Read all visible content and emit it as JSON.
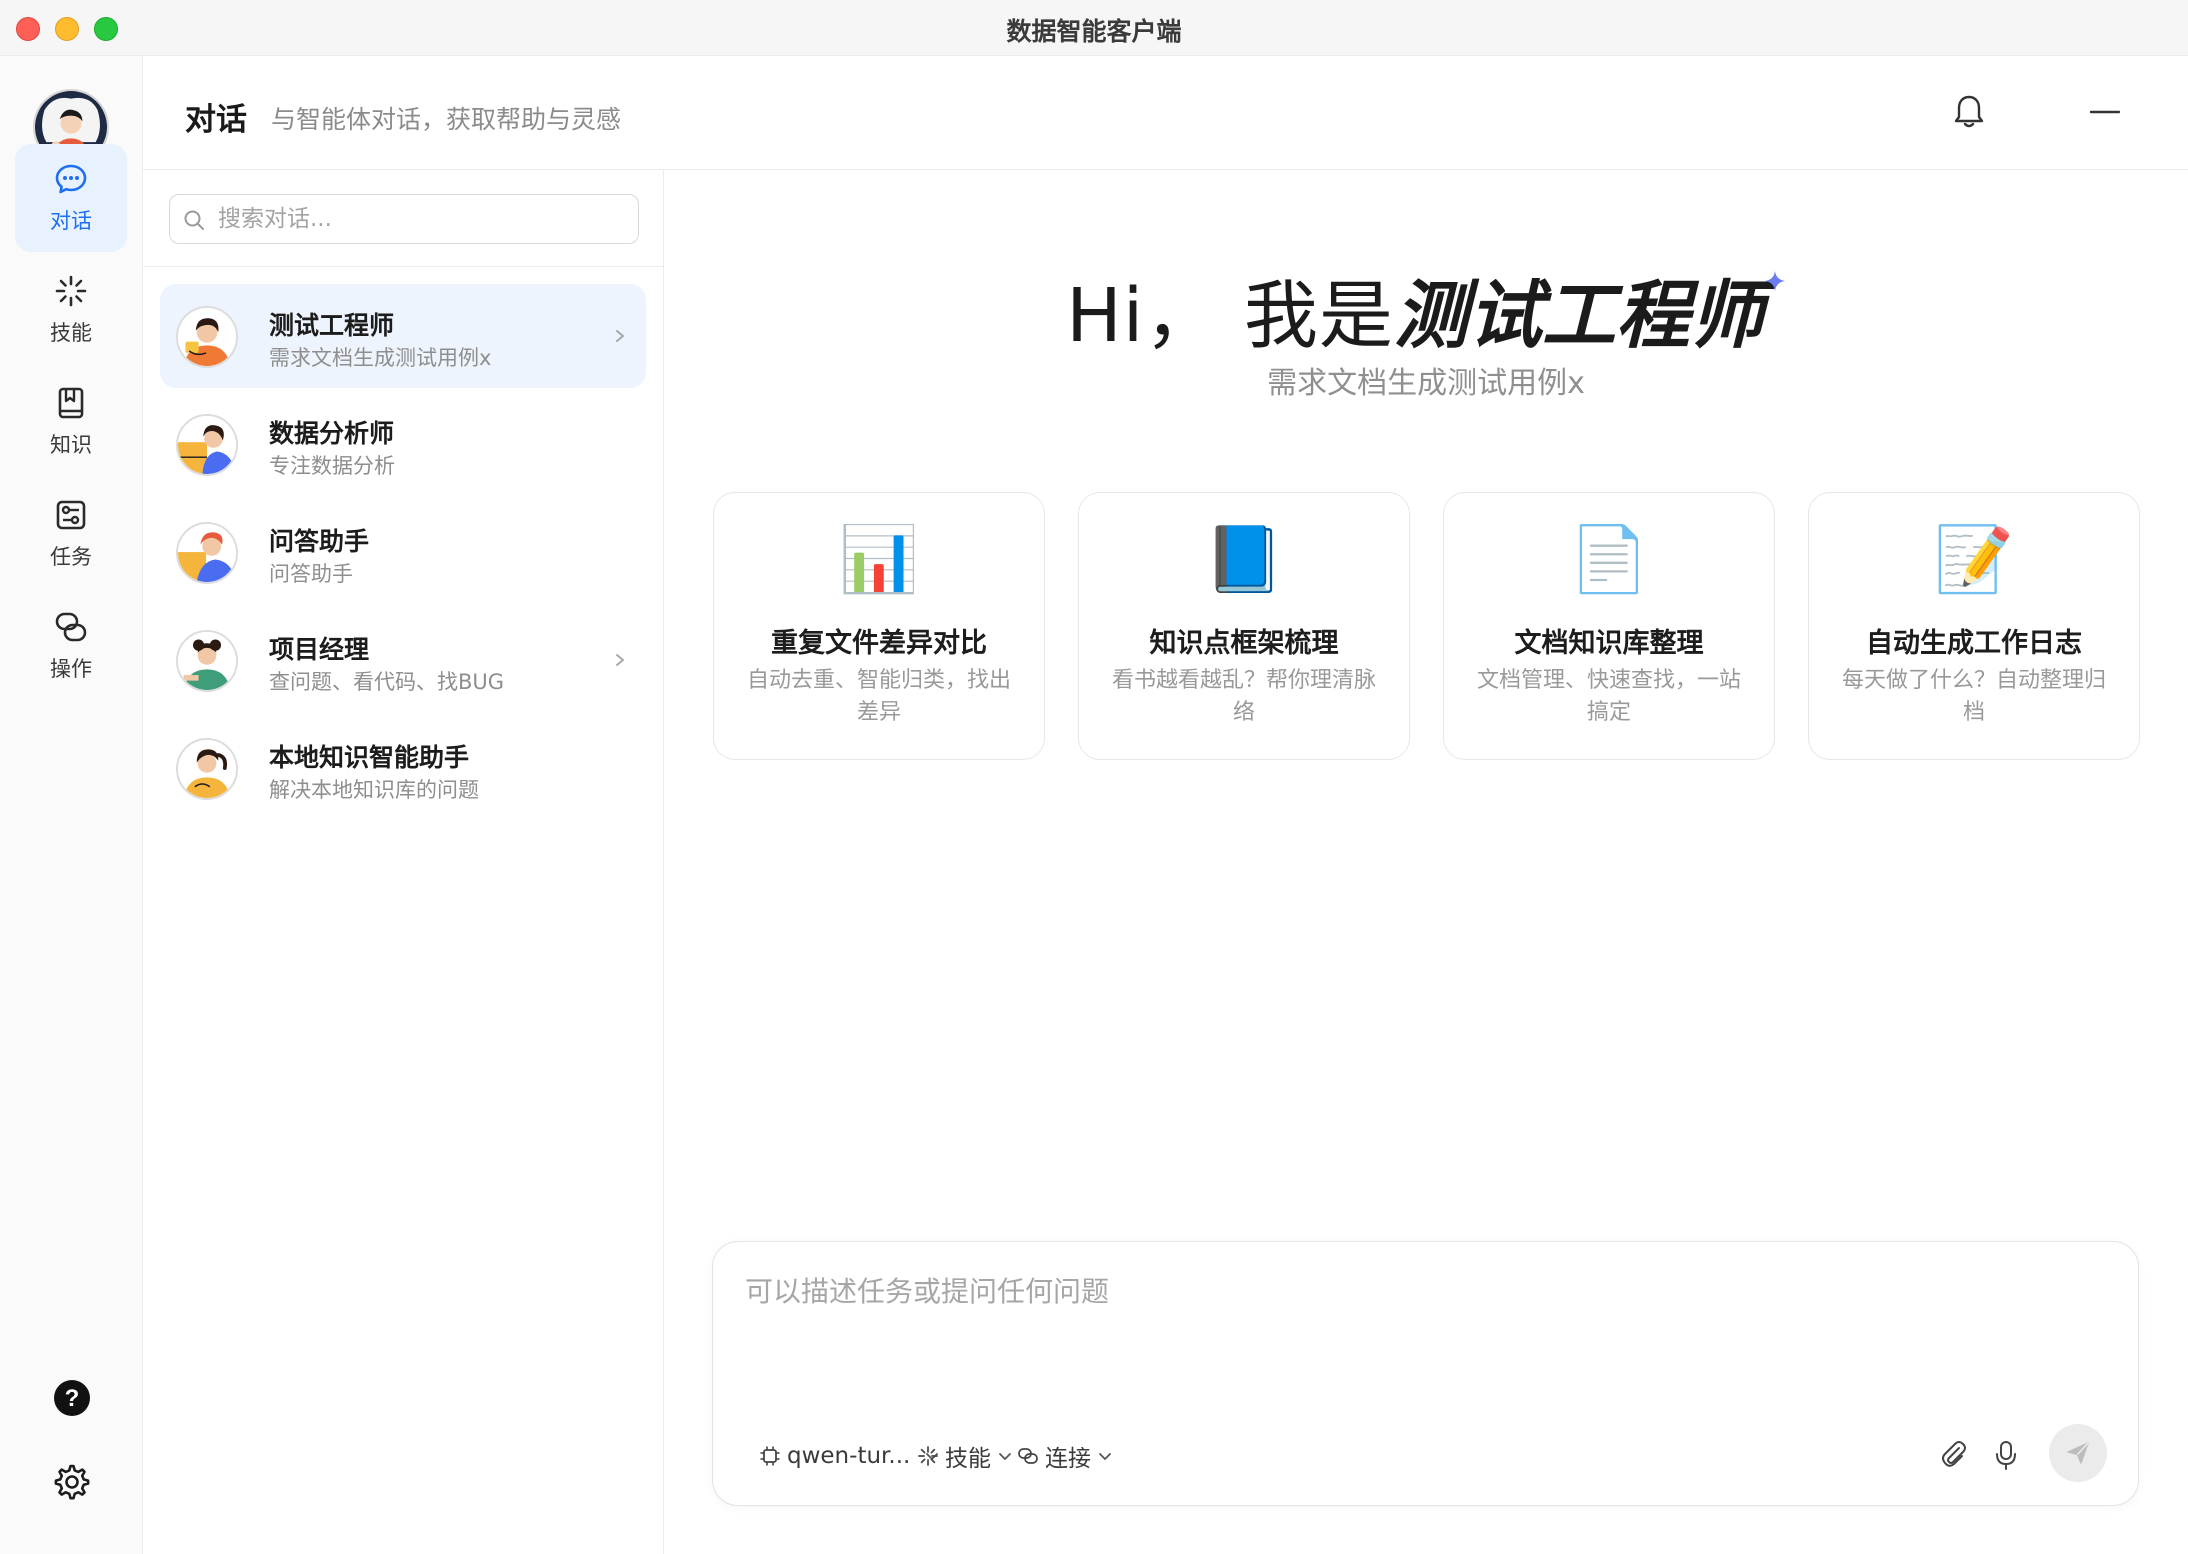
{
  "window": {
    "title": "数据智能客户端"
  },
  "rail": {
    "nav": [
      {
        "label": "对话",
        "icon": "chat-icon",
        "active": true
      },
      {
        "label": "技能",
        "icon": "sparkle-burst-icon",
        "active": false
      },
      {
        "label": "知识",
        "icon": "book-icon",
        "active": false
      },
      {
        "label": "任务",
        "icon": "task-sliders-icon",
        "active": false
      },
      {
        "label": "操作",
        "icon": "link-loop-icon",
        "active": false
      }
    ],
    "bottom_icons": [
      "help-icon",
      "settings-icon"
    ]
  },
  "header": {
    "title": "对话",
    "subtitle": "与智能体对话，获取帮助与灵感"
  },
  "search": {
    "placeholder": "搜索对话..."
  },
  "agents": [
    {
      "name": "测试工程师",
      "desc": "需求文档生成测试用例x",
      "selected": true,
      "chevron": true
    },
    {
      "name": "数据分析师",
      "desc": "专注数据分析",
      "selected": false,
      "chevron": false
    },
    {
      "name": "问答助手",
      "desc": "问答助手",
      "selected": false,
      "chevron": false
    },
    {
      "name": "项目经理",
      "desc": "查问题、看代码、找BUG",
      "selected": false,
      "chevron": true
    },
    {
      "name": "本地知识智能助手",
      "desc": "解决本地知识库的问题",
      "selected": false,
      "chevron": false
    }
  ],
  "main": {
    "greeting_prefix": "Hi，  我是",
    "greeting_name": "测试工程师",
    "subtitle": "需求文档生成测试用例x",
    "cards": [
      {
        "icon": "📊",
        "title": "重复文件差异对比",
        "desc": "自动去重、智能归类，找出差异"
      },
      {
        "icon": "📘",
        "title": "知识点框架梳理",
        "desc": "看书越看越乱？帮你理清脉络"
      },
      {
        "icon": "📄",
        "title": "文档知识库整理",
        "desc": "文档管理、快速查找，一站搞定"
      },
      {
        "icon": "📝",
        "title": "自动生成工作日志",
        "desc": "每天做了什么？自动整理归档"
      }
    ]
  },
  "composer": {
    "placeholder": "可以描述任务或提问任何问题",
    "model": "qwen-tur...",
    "skill_label": "技能",
    "connect_label": "连接"
  },
  "colors": {
    "accent": "#1e6ff0",
    "selected_bg": "#eef4fd",
    "nav_active_bg": "#e8f1fe",
    "sparkle": "#6b7cf0"
  }
}
